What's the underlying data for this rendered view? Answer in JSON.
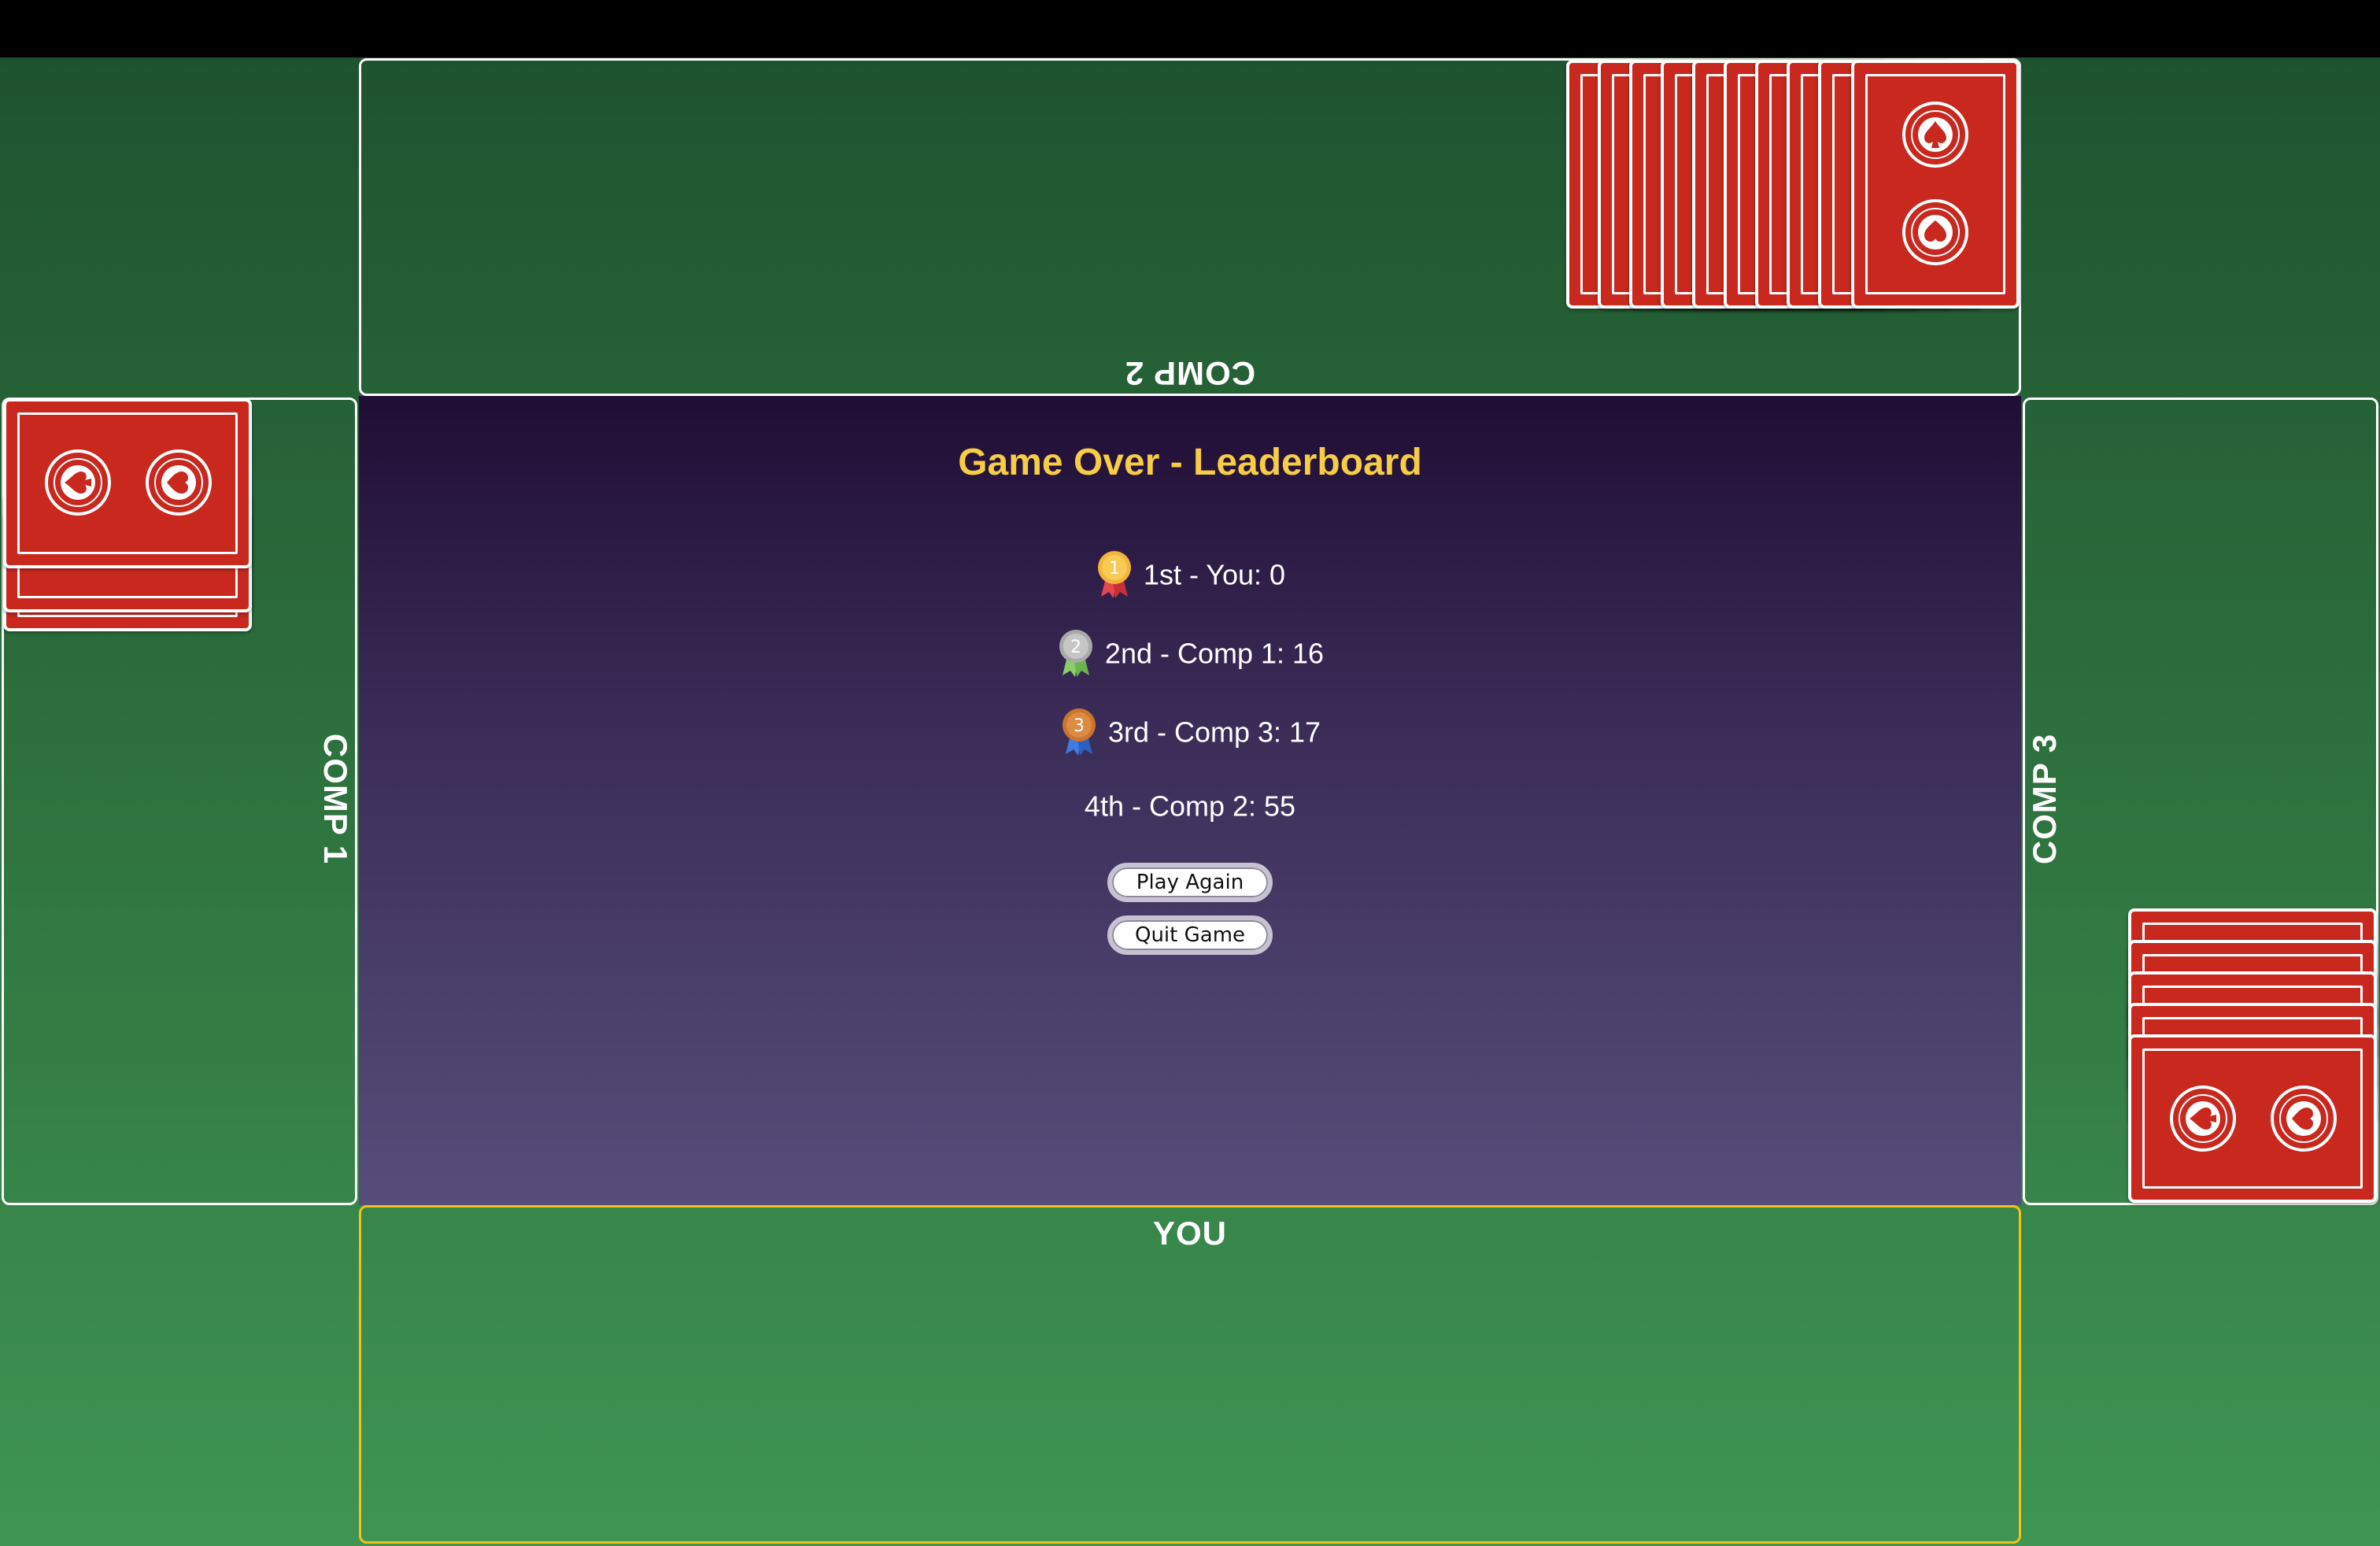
{
  "zones": {
    "top_label": "COMP 2",
    "left_label": "COMP 1",
    "right_label": "COMP 3",
    "bottom_label": "YOU"
  },
  "leaderboard": {
    "title": "Game Over - Leaderboard",
    "rows": [
      {
        "text": "1st - You: 0",
        "medal": "gold-medal-icon",
        "medal_number": "1"
      },
      {
        "text": "2nd - Comp 1: 16",
        "medal": "silver-medal-icon",
        "medal_number": "2"
      },
      {
        "text": "3rd - Comp 3: 17",
        "medal": "bronze-medal-icon",
        "medal_number": "3"
      },
      {
        "text": "4th - Comp 2: 55"
      }
    ]
  },
  "buttons": {
    "play_again": "Play Again",
    "quit_game": "Quit Game"
  },
  "colors": {
    "card_back": "#c8281e",
    "title": "#f6cd45",
    "you_border": "#f2c21a"
  },
  "card_back_emblem": "spade-and-heart-emblem-icon"
}
